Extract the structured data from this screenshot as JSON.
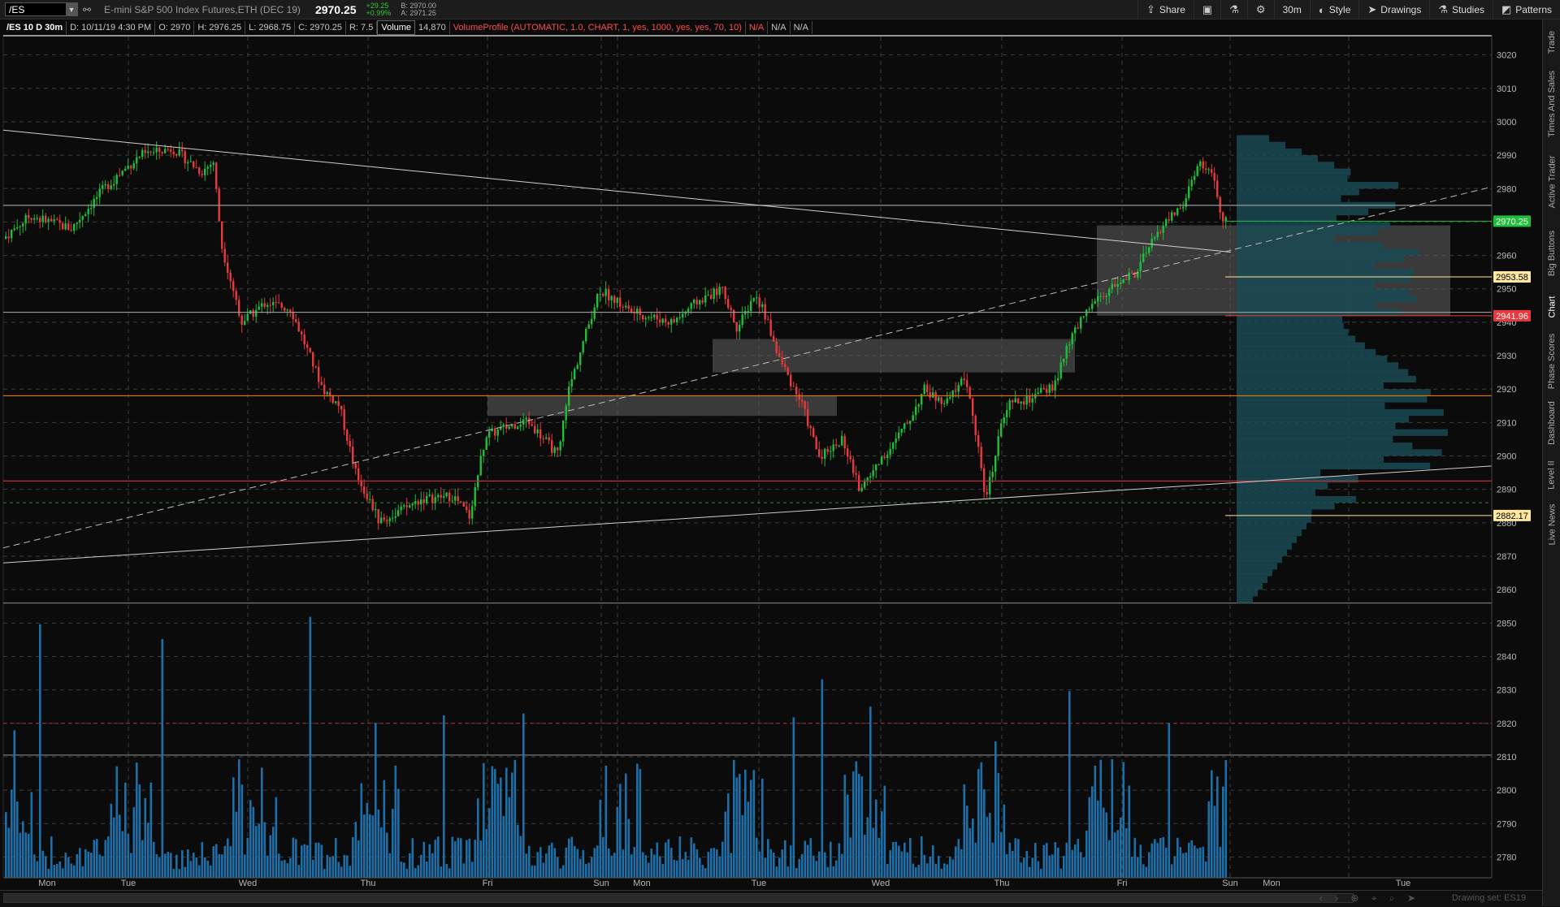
{
  "toolbar": {
    "symbol": "/ES",
    "link_icon": "chain-link-icon",
    "instrument_name": "E-mini S&P 500 Index Futures,ETH (DEC 19)",
    "last_price": "2970.25",
    "net_change": "+29.25",
    "pct_change": "+0.99%",
    "bid": "B: 2970.00",
    "ask": "A: 2971.25",
    "buttons": [
      {
        "label": "Share",
        "icon": "share-icon"
      },
      {
        "label": "",
        "icon": "snapshot-icon"
      },
      {
        "label": "",
        "icon": "flask-icon"
      },
      {
        "label": "",
        "icon": "gear-icon"
      },
      {
        "label": "30m",
        "icon": ""
      },
      {
        "label": "Style",
        "icon": "style-icon"
      },
      {
        "label": "Drawings",
        "icon": "cursor-icon"
      },
      {
        "label": "Studies",
        "icon": "beaker-icon"
      },
      {
        "label": "Patterns",
        "icon": "patterns-icon"
      }
    ]
  },
  "info_row": {
    "title": "/ES 10 D 30m",
    "date": "D: 10/11/19 4:30 PM",
    "open": "O: 2970",
    "high": "H: 2976.25",
    "low": "L: 2968.75",
    "close": "C: 2970.25",
    "range": "R: 7.5",
    "volume_label": "Volume",
    "volume_value": "14,870",
    "volume_profile": "VolumeProfile (AUTOMATIC, 1.0, CHART, 1, yes, 1000, yes, yes, 70, 10)",
    "na1": "N/A",
    "na2": "N/A",
    "na3": "N/A"
  },
  "chart_data": {
    "type": "candlestick",
    "symbol": "/ES",
    "interval": "30m",
    "price_axis": {
      "min": 2775,
      "max": 3025,
      "ticks": [
        "3020",
        "3010",
        "3000",
        "2990",
        "2980",
        "2970",
        "2960",
        "2950",
        "2940",
        "2930",
        "2920",
        "2910",
        "2900",
        "2890",
        "2880",
        "2870",
        "2860",
        "2850",
        "2840",
        "2830",
        "2820",
        "2810",
        "2800",
        "2790",
        "2780"
      ]
    },
    "price_markers": [
      {
        "label": "2970.25",
        "color": "#1fbf3a",
        "text_color": "#ffffff"
      },
      {
        "label": "2953.58",
        "color": "#ffe7a0",
        "text_color": "#000000"
      },
      {
        "label": "2941.96",
        "color": "#e8393c",
        "text_color": "#ffffff"
      },
      {
        "label": "2882.17",
        "color": "#ffe7a0",
        "text_color": "#000000"
      }
    ],
    "day_labels": [
      "Mon",
      "Tue",
      "Wed",
      "Thu",
      "Fri",
      "Sun",
      "Mon",
      "Tue",
      "Wed",
      "Thu",
      "Fri",
      "Sun",
      "Mon",
      "Tue"
    ],
    "session_closes": [
      {
        "day": "Mon",
        "close": 2970
      },
      {
        "day": "Tue",
        "close": 2946
      },
      {
        "day": "Wed",
        "close": 2886
      },
      {
        "day": "Thu",
        "close": 2920
      },
      {
        "day": "Fri",
        "close": 2936
      },
      {
        "day": "Mon",
        "close": 2941
      },
      {
        "day": "Tue",
        "close": 2898
      },
      {
        "day": "Wed",
        "close": 2895
      },
      {
        "day": "Thu",
        "close": 2944
      },
      {
        "day": "Fri",
        "close": 2970.25
      }
    ],
    "horizontal_levels": [
      {
        "price": 2918,
        "color": "#e07b00"
      },
      {
        "price": 2892.5,
        "color": "#c03030"
      },
      {
        "price": 2975,
        "color": "#9a9a9a"
      },
      {
        "price": 2943,
        "color": "#9a9a9a"
      }
    ],
    "supply_demand_zones": [
      {
        "from": 2912,
        "to": 2918
      },
      {
        "from": 2925,
        "to": 2935
      },
      {
        "from": 2942,
        "to": 2969
      }
    ],
    "colors": {
      "up": "#1fbf3a",
      "down": "#e8393c",
      "volume": "#1c6fa8",
      "profile": "#1a4a55",
      "grid": "#4a4a4a"
    }
  },
  "side_tabs": [
    "Trade",
    "Times And Sales",
    "Active Trader",
    "Big Buttons",
    "Chart",
    "Phase Scores",
    "Dashboard",
    "Level II",
    "Live News"
  ],
  "bottom": {
    "drawing_set": "Drawing set: ES19",
    "icons": [
      "scroll-left-icon",
      "scroll-right-icon",
      "zoom-icon",
      "crosshair-icon",
      "magnifier-icon",
      "cursor-icon"
    ]
  }
}
